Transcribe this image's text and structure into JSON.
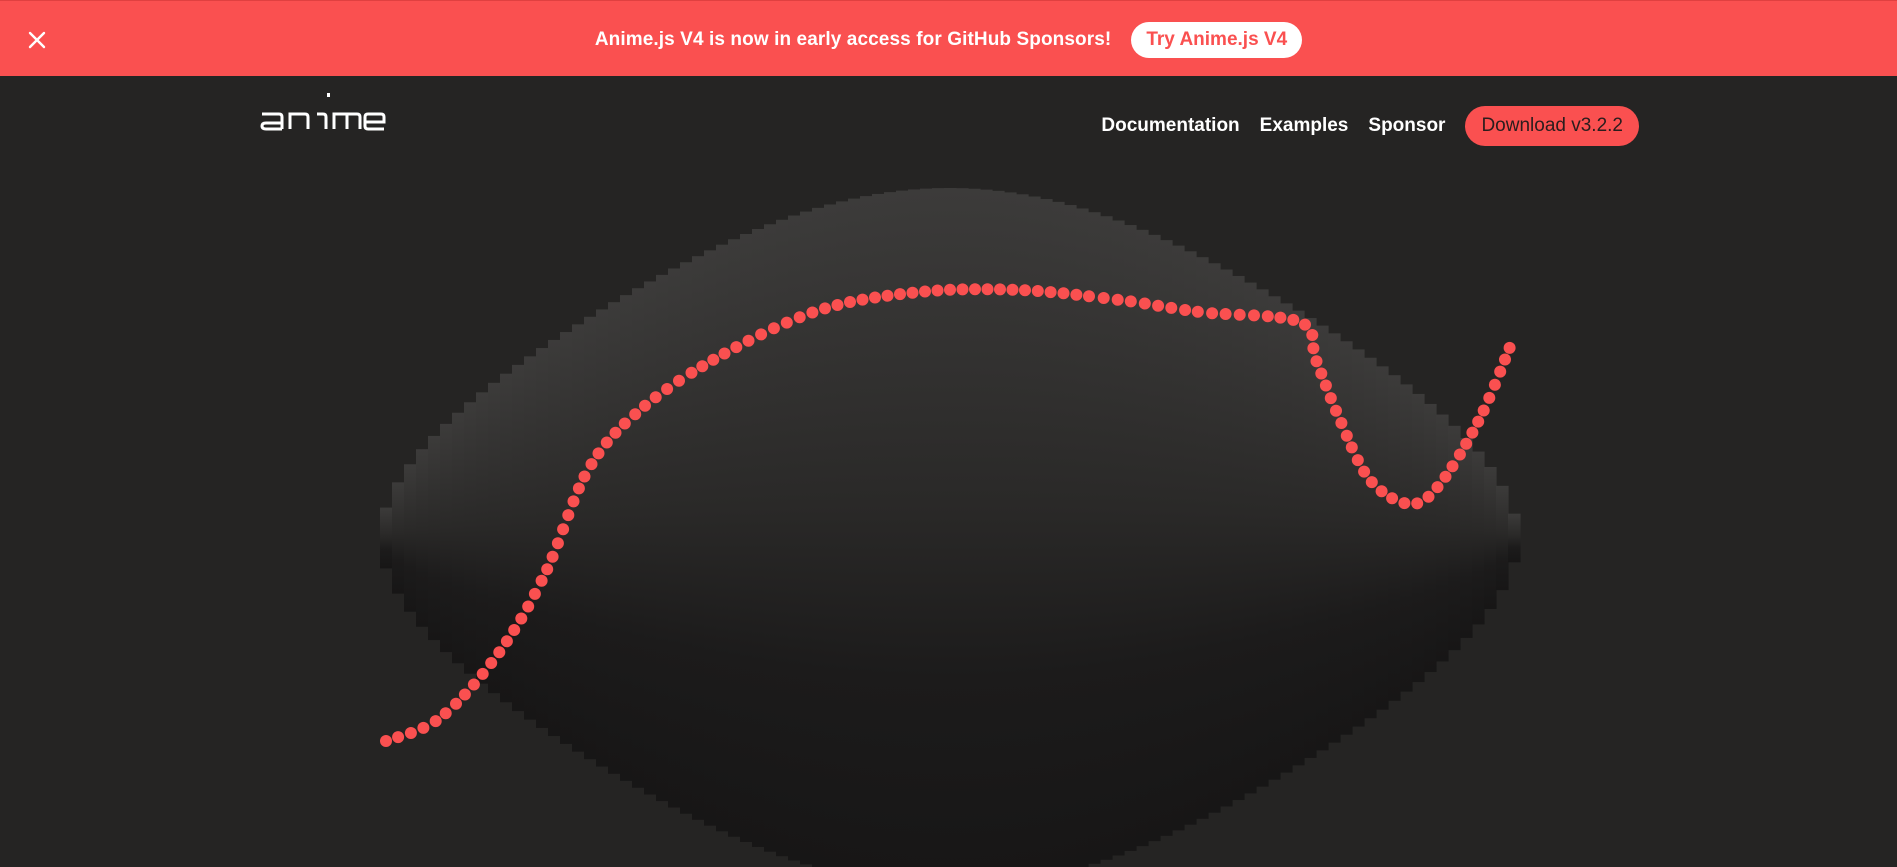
{
  "banner": {
    "message": "Anime.js V4 is now in early access for GitHub Sponsors!",
    "cta_label": "Try Anime.js V4",
    "close_icon": "close-icon",
    "background_color": "#fa5050"
  },
  "header": {
    "logo_text": "anime",
    "nav": [
      {
        "label": "Documentation"
      },
      {
        "label": "Examples"
      },
      {
        "label": "Sponsor"
      }
    ],
    "download_label": "Download v3.2.2"
  },
  "colors": {
    "accent": "#fa5050",
    "background": "#252423"
  }
}
